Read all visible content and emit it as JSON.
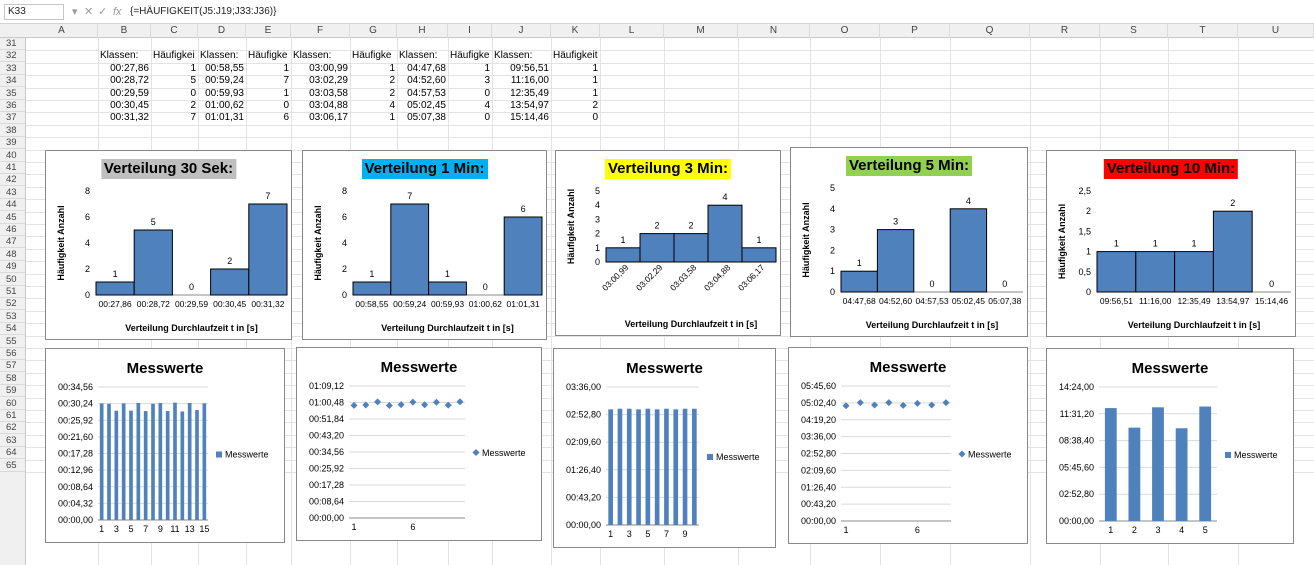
{
  "formula_bar": {
    "cell_ref": "K33",
    "formula": "{=HÄUFIGKEIT(J5:J19;J33:J36)}"
  },
  "columns": [
    "A",
    "B",
    "C",
    "D",
    "E",
    "F",
    "G",
    "H",
    "I",
    "J",
    "K",
    "L",
    "M",
    "N",
    "O",
    "P",
    "Q",
    "R",
    "S",
    "T",
    "U"
  ],
  "rows": [
    "31",
    "32",
    "33",
    "34",
    "35",
    "36",
    "37",
    "38",
    "39",
    "40",
    "41",
    "42",
    "43",
    "44",
    "45",
    "46",
    "47",
    "48",
    "49",
    "50",
    "51",
    "52",
    "53",
    "54",
    "55",
    "56",
    "57",
    "58",
    "59",
    "60",
    "61",
    "62",
    "63",
    "64",
    "65"
  ],
  "table": {
    "headers": [
      "Klassen:",
      "Häufigkei",
      "Klassen:",
      "Häufigke",
      "Klassen:",
      "Häufigke",
      "Klassen:",
      "Häufigkei",
      "Klassen:",
      "Häufigkeit:"
    ],
    "rows": [
      [
        "00:27,86",
        "1",
        "00:58,55",
        "1",
        "03:00,99",
        "1",
        "04:47,68",
        "1",
        "09:56,51",
        "1"
      ],
      [
        "00:28,72",
        "5",
        "00:59,24",
        "7",
        "03:02,29",
        "2",
        "04:52,60",
        "3",
        "11:16,00",
        "1"
      ],
      [
        "00:29,59",
        "0",
        "00:59,93",
        "1",
        "03:03,58",
        "2",
        "04:57,53",
        "0",
        "12:35,49",
        "1"
      ],
      [
        "00:30,45",
        "2",
        "01:00,62",
        "0",
        "03:04,88",
        "4",
        "05:02,45",
        "4",
        "13:54,97",
        "2"
      ],
      [
        "00:31,32",
        "7",
        "01:01,31",
        "6",
        "03:06,17",
        "1",
        "05:07,38",
        "0",
        "15:14,46",
        "0"
      ]
    ]
  },
  "chart_data": [
    {
      "type": "bar",
      "title": "Verteilung 30 Sek:",
      "title_bg": "#bfbfbf",
      "title_color": "#000000",
      "ylabel": "Häufigkeit Anzahl",
      "xlabel": "Verteilung Durchlaufzeit t in [s]",
      "categories": [
        "00:27,86",
        "00:28,72",
        "00:29,59",
        "00:30,45",
        "00:31,32"
      ],
      "values": [
        1,
        5,
        0,
        2,
        7
      ],
      "yticks": [
        "0",
        "2",
        "4",
        "6",
        "8"
      ],
      "ylim": [
        0,
        8
      ]
    },
    {
      "type": "bar",
      "title": "Verteilung 1 Min:",
      "title_bg": "#00b0f0",
      "title_color": "#000000",
      "ylabel": "Häufigkeit Anzahl",
      "xlabel": "Verteilung Durchlaufzeit t in [s]",
      "categories": [
        "00:58,55",
        "00:59,24",
        "00:59,93",
        "01:00,62",
        "01:01,31"
      ],
      "values": [
        1,
        7,
        1,
        0,
        6
      ],
      "yticks": [
        "0",
        "2",
        "4",
        "6",
        "8"
      ],
      "ylim": [
        0,
        8
      ]
    },
    {
      "type": "bar",
      "title": "Verteilung 3 Min:",
      "title_bg": "#ffff00",
      "title_color": "#000000",
      "ylabel": "Häufigkeit Anzahl",
      "xlabel": "Verteilung Durchlaufzeit t in [s]",
      "categories": [
        "03:00,99",
        "03:02,29",
        "03:03,58",
        "03:04,88",
        "03:06,17"
      ],
      "values": [
        1,
        2,
        2,
        4,
        1
      ],
      "yticks": [
        "0",
        "1",
        "2",
        "3",
        "4",
        "5"
      ],
      "ylim": [
        0,
        5
      ]
    },
    {
      "type": "bar",
      "title": "Verteilung 5 Min:",
      "title_bg": "#92d050",
      "title_color": "#000000",
      "ylabel": "Häufigkeit Anzahl",
      "xlabel": "Verteilung Durchlaufzeit t in [s]",
      "categories": [
        "04:47,68",
        "04:52,60",
        "04:57,53",
        "05:02,45",
        "05:07,38"
      ],
      "values": [
        1,
        3,
        0,
        4,
        0
      ],
      "yticks": [
        "0",
        "1",
        "2",
        "3",
        "4",
        "5"
      ],
      "ylim": [
        0,
        5
      ]
    },
    {
      "type": "bar",
      "title": "Verteilung 10 Min:",
      "title_bg": "#ff0000",
      "title_color": "#000000",
      "ylabel": "Häufigkeit Anzahl",
      "xlabel": "Verteilung Durchlaufzeit t in [s]",
      "categories": [
        "09:56,51",
        "11:16,00",
        "12:35,49",
        "13:54,97",
        "15:14,46"
      ],
      "values": [
        1,
        1,
        1,
        2,
        0
      ],
      "yticks": [
        "0",
        "0,5",
        "1",
        "1,5",
        "2",
        "2,5"
      ],
      "ylim": [
        0,
        2.5
      ]
    },
    {
      "type": "bar",
      "title": "Messwerte",
      "legend": "Messwerte",
      "yticks": [
        "00:00,00",
        "00:04,32",
        "00:08,64",
        "00:12,96",
        "00:17,28",
        "00:21,60",
        "00:25,92",
        "00:30,24",
        "00:34,56"
      ],
      "ylim": [
        0,
        34.56
      ],
      "xticks": [
        "1",
        "3",
        "5",
        "7",
        "9",
        "11",
        "13",
        "15"
      ],
      "values": [
        30.3,
        30.2,
        28.4,
        30.3,
        28.4,
        30.4,
        28.3,
        30.2,
        30.4,
        28.3,
        30.5,
        28.2,
        30.4,
        28.6,
        30.3
      ]
    },
    {
      "type": "scatter",
      "title": "Messwerte",
      "legend": "Messwerte",
      "yticks": [
        "00:00,00",
        "00:08,64",
        "00:17,28",
        "00:25,92",
        "00:34,56",
        "00:43,20",
        "00:51,84",
        "01:00,48",
        "01:09,12"
      ],
      "ylim": [
        0,
        69.12
      ],
      "xticks": [
        "1",
        "6"
      ],
      "values": [
        59.0,
        59.2,
        60.8,
        58.9,
        59.4,
        60.7,
        59.3,
        60.6,
        59.1,
        60.9
      ]
    },
    {
      "type": "bar",
      "title": "Messwerte",
      "legend": "Messwerte",
      "yticks": [
        "00:00,00",
        "00:43,20",
        "01:26,40",
        "02:09,60",
        "02:52,80",
        "03:36,00"
      ],
      "ylim": [
        0,
        216
      ],
      "xticks": [
        "1",
        "3",
        "5",
        "7",
        "9"
      ],
      "values": [
        181,
        182,
        182,
        181,
        182,
        181,
        182,
        181,
        182,
        182
      ]
    },
    {
      "type": "scatter",
      "title": "Messwerte",
      "legend": "Messwerte",
      "yticks": [
        "00:00,00",
        "00:43,20",
        "01:26,40",
        "02:09,60",
        "02:52,80",
        "03:36,00",
        "04:19,20",
        "05:02,40",
        "05:45,60"
      ],
      "ylim": [
        0,
        345.6
      ],
      "xticks": [
        "1",
        "6"
      ],
      "values": [
        295,
        303,
        297,
        303,
        296,
        301,
        297,
        303
      ]
    },
    {
      "type": "bar",
      "title": "Messwerte",
      "legend": "Messwerte",
      "yticks": [
        "00:00,00",
        "02:52,80",
        "05:45,60",
        "08:38,40",
        "11:31,20",
        "14:24,00"
      ],
      "ylim": [
        0,
        864
      ],
      "xticks": [
        "1",
        "2",
        "3",
        "4",
        "5"
      ],
      "values": [
        728,
        602,
        733,
        598,
        738
      ]
    }
  ]
}
